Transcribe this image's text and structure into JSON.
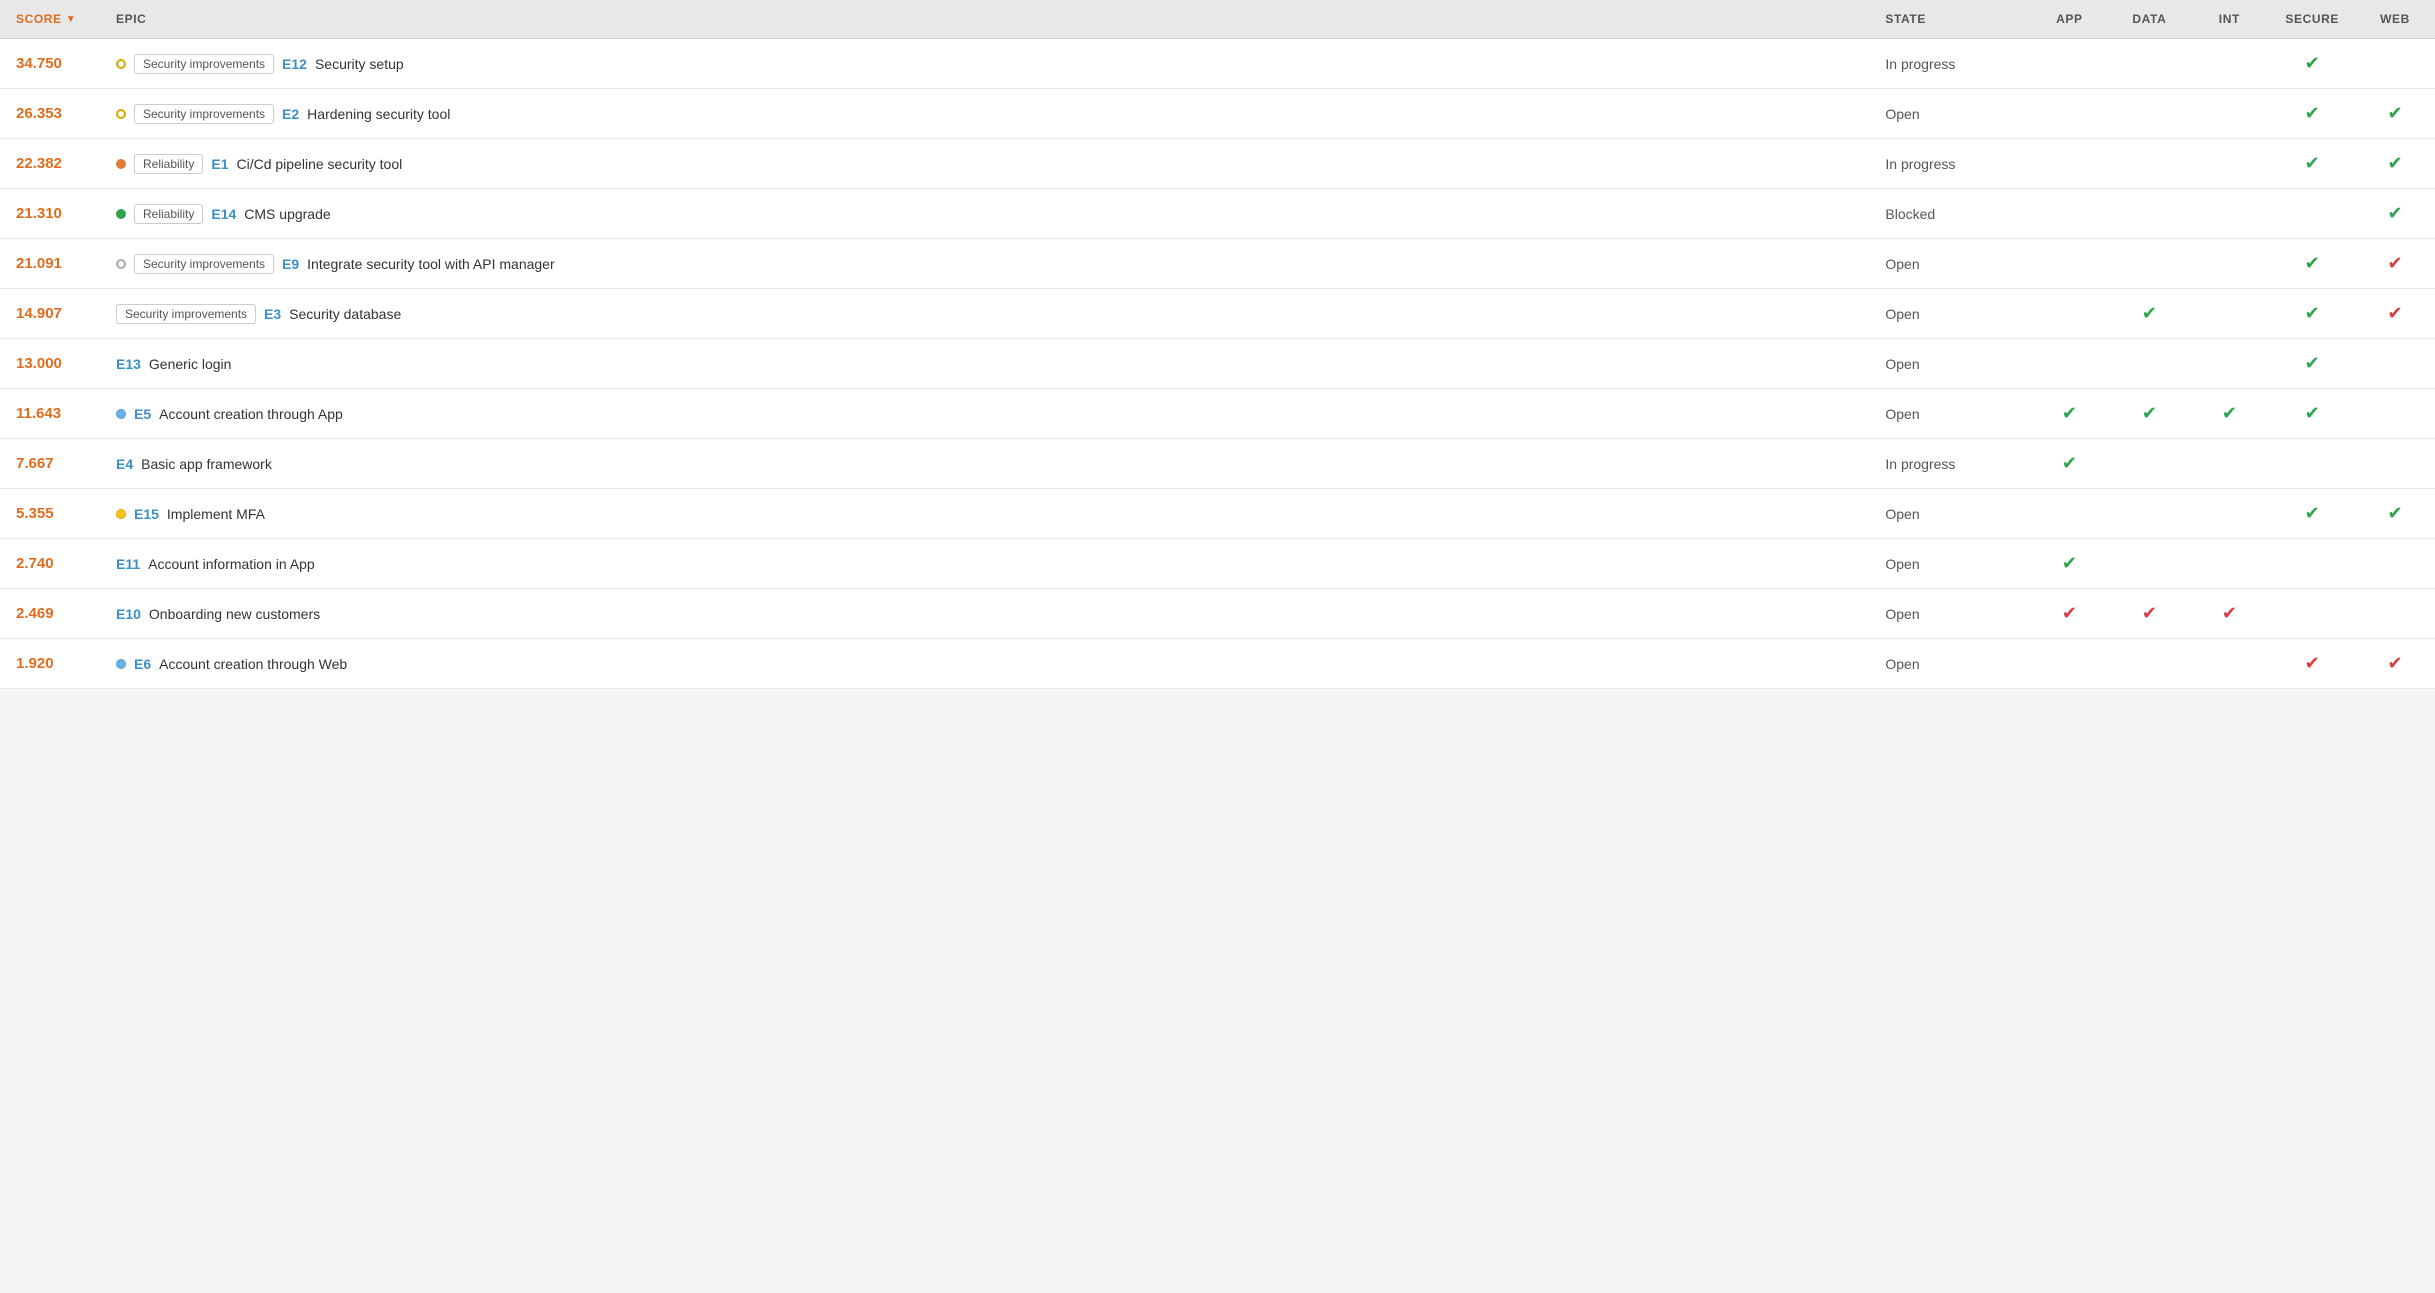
{
  "header": {
    "score_label": "SCORE",
    "epic_label": "EPIC",
    "state_label": "STATE",
    "app_label": "APP",
    "data_label": "DATA",
    "int_label": "INT",
    "secure_label": "SECURE",
    "web_label": "WEB"
  },
  "rows": [
    {
      "score": "34.750",
      "dot": "yellow-outline",
      "tag": "Security improvements",
      "epic_id": "E12",
      "epic_title": "Security setup",
      "state": "In progress",
      "app": false,
      "data": false,
      "int": false,
      "secure": "green",
      "web": false
    },
    {
      "score": "26.353",
      "dot": "yellow-outline",
      "tag": "Security improvements",
      "epic_id": "E2",
      "epic_title": "Hardening security tool",
      "state": "Open",
      "app": false,
      "data": false,
      "int": false,
      "secure": "green",
      "web": "green"
    },
    {
      "score": "22.382",
      "dot": "orange",
      "tag": "Reliability",
      "epic_id": "E1",
      "epic_title": "Ci/Cd pipeline security tool",
      "state": "In progress",
      "app": false,
      "data": false,
      "int": false,
      "secure": "green",
      "web": "green"
    },
    {
      "score": "21.310",
      "dot": "green",
      "tag": "Reliability",
      "epic_id": "E14",
      "epic_title": "CMS upgrade",
      "state": "Blocked",
      "app": false,
      "data": false,
      "int": false,
      "secure": false,
      "web": "green"
    },
    {
      "score": "21.091",
      "dot": "gray",
      "tag": "Security improvements",
      "epic_id": "E9",
      "epic_title": "Integrate security tool with API manager",
      "state": "Open",
      "app": false,
      "data": false,
      "int": false,
      "secure": "green",
      "web": "red"
    },
    {
      "score": "14.907",
      "dot": null,
      "tag": "Security improvements",
      "epic_id": "E3",
      "epic_title": "Security database",
      "state": "Open",
      "app": false,
      "data": "green",
      "int": false,
      "secure": "green",
      "web": "red"
    },
    {
      "score": "13.000",
      "dot": null,
      "tag": null,
      "epic_id": "E13",
      "epic_title": "Generic login",
      "state": "Open",
      "app": false,
      "data": false,
      "int": false,
      "secure": "green",
      "web": false
    },
    {
      "score": "11.643",
      "dot": "blue",
      "tag": null,
      "epic_id": "E5",
      "epic_title": "Account creation through App",
      "state": "Open",
      "app": "green",
      "data": "green",
      "int": "green",
      "secure": "green",
      "web": false
    },
    {
      "score": "7.667",
      "dot": null,
      "tag": null,
      "epic_id": "E4",
      "epic_title": "Basic app framework",
      "state": "In progress",
      "app": "green",
      "data": false,
      "int": false,
      "secure": false,
      "web": false
    },
    {
      "score": "5.355",
      "dot": "yellow",
      "tag": null,
      "epic_id": "E15",
      "epic_title": "Implement MFA",
      "state": "Open",
      "app": false,
      "data": false,
      "int": false,
      "secure": "green",
      "web": "green"
    },
    {
      "score": "2.740",
      "dot": null,
      "tag": null,
      "epic_id": "E11",
      "epic_title": "Account information in App",
      "state": "Open",
      "app": "green",
      "data": false,
      "int": false,
      "secure": false,
      "web": false
    },
    {
      "score": "2.469",
      "dot": null,
      "tag": null,
      "epic_id": "E10",
      "epic_title": "Onboarding new customers",
      "state": "Open",
      "app": "red",
      "data": "red",
      "int": "red",
      "secure": false,
      "web": false
    },
    {
      "score": "1.920",
      "dot": "blue",
      "tag": null,
      "epic_id": "E6",
      "epic_title": "Account creation through Web",
      "state": "Open",
      "app": false,
      "data": false,
      "int": false,
      "secure": "red",
      "web": "red"
    }
  ],
  "icons": {
    "check": "✔",
    "sort_desc": "▼"
  }
}
